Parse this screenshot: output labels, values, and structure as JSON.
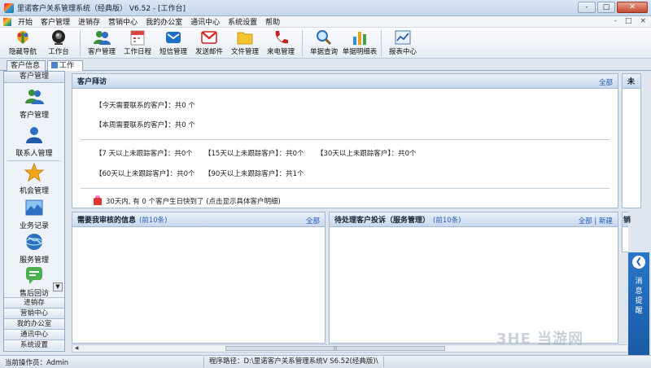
{
  "window": {
    "title": "里诺客户关系管理系统（经典版） V6.52 - [工作台]",
    "buttons": [
      "-",
      "□",
      "✕"
    ]
  },
  "menu": {
    "items": [
      "开始",
      "客户管理",
      "进销存",
      "营销中心",
      "我的办公室",
      "通讯中心",
      "系统设置",
      "帮助"
    ],
    "right": [
      "-",
      "□",
      "×"
    ]
  },
  "toolbar": {
    "items": [
      {
        "label": "隐藏导航",
        "icon": "hide-nav-icon"
      },
      {
        "label": "工作台",
        "icon": "workbench-icon"
      },
      {
        "label": "客户管理",
        "icon": "customer-management-icon"
      },
      {
        "label": "工作日程",
        "icon": "calendar-icon"
      },
      {
        "label": "短信管理",
        "icon": "sms-icon"
      },
      {
        "label": "发送邮件",
        "icon": "email-icon"
      },
      {
        "label": "文件管理",
        "icon": "folder-icon"
      },
      {
        "label": "来电管理",
        "icon": "phone-icon"
      },
      {
        "label": "单据查询",
        "icon": "magnifier-icon"
      },
      {
        "label": "单据明细表",
        "icon": "bar-chart-icon"
      },
      {
        "label": "报表中心",
        "icon": "report-center-icon"
      }
    ]
  },
  "tabs": {
    "customer_info": "客户信息",
    "workbench": "工作台"
  },
  "sidebar": {
    "header": "客户管理",
    "items": [
      {
        "label": "客户管理",
        "icon": "users-icon"
      },
      {
        "label": "联系人管理",
        "icon": "contact-icon"
      },
      {
        "label": "机会管理",
        "icon": "star-icon"
      },
      {
        "label": "业务记录",
        "icon": "records-icon"
      },
      {
        "label": "服务管理",
        "icon": "globe-icon"
      },
      {
        "label": "售后回访",
        "icon": "chat-icon"
      }
    ],
    "scroll_arrow": "▼",
    "bottom": [
      "进销存",
      "营销中心",
      "我的办公室",
      "通讯中心",
      "系统设置"
    ]
  },
  "visit_panel": {
    "title": "客户拜访",
    "link": "全部",
    "today": "【今天需要联系的客户】：共0 个",
    "week": "【本周需要联系的客户】：共0 个",
    "rows": [
      [
        "【7 天以上未跟踪客户】：共0个",
        "【15天以上未跟踪客户】：共0个",
        "【30天以上未跟踪客户】：共0个"
      ],
      [
        "【60天以上未跟踪客户】：共0个",
        "【90天以上未跟踪客户】：共1个",
        ""
      ]
    ],
    "birthday": "30天内, 有 0 个客户生日快到了 (点击显示具体客户明细)"
  },
  "right_panel_title": "未",
  "right_panel_title2": "销",
  "audit_panel": {
    "title": "需要我审核的信息",
    "count": "(前10条)",
    "link": "全部"
  },
  "complaint_panel": {
    "title": "待处理客户投诉（服务管理）",
    "count": "(前10条)",
    "link": "全部 | 新建"
  },
  "message": {
    "arrow": "❮",
    "text": "消息提醒"
  },
  "status": {
    "operator": "当前操作员：Admin",
    "path": "程序路径：D:\\里诺客户关系管理系统V S6.52(经典版)\\"
  },
  "scroll": {
    "left": "◀",
    "right": "▶",
    "grip": "|||"
  },
  "watermark": "3HE 当游网",
  "colors": {
    "accent": "#1f56b5",
    "panel_header": "#c7d8ed",
    "message_bg": "#1b5aa5"
  }
}
